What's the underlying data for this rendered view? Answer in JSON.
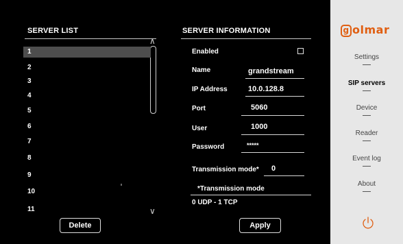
{
  "server_list": {
    "title": "SERVER LIST",
    "items": [
      "1",
      "2",
      "3",
      "4",
      "5",
      "6",
      "7",
      "8",
      "9",
      "10",
      "11"
    ],
    "selected": "1",
    "delete_label": "Delete"
  },
  "server_info": {
    "title": "SERVER INFORMATION",
    "enabled_label": "Enabled",
    "name_label": "Name",
    "name_value": "grandstream",
    "ip_label": "IP Address",
    "ip_value": "10.0.128.8",
    "port_label": "Port",
    "port_value": "5060",
    "user_label": "User",
    "user_value": "1000",
    "password_label": "Password",
    "password_value": "*****",
    "transmission_label": "Transmission mode*",
    "transmission_value": "0",
    "note_title": "*Transmission mode",
    "note_text": "0 UDP - 1 TCP",
    "apply_label": "Apply"
  },
  "sidebar": {
    "logo": "golmar",
    "items": [
      {
        "label": "Settings",
        "active": false
      },
      {
        "label": "SIP servers",
        "active": true
      },
      {
        "label": "Device",
        "active": false
      },
      {
        "label": "Reader",
        "active": false
      },
      {
        "label": "Event log",
        "active": false
      },
      {
        "label": "About",
        "active": false
      }
    ],
    "power_icon": "power-icon",
    "accent_color": "#e05f12"
  }
}
